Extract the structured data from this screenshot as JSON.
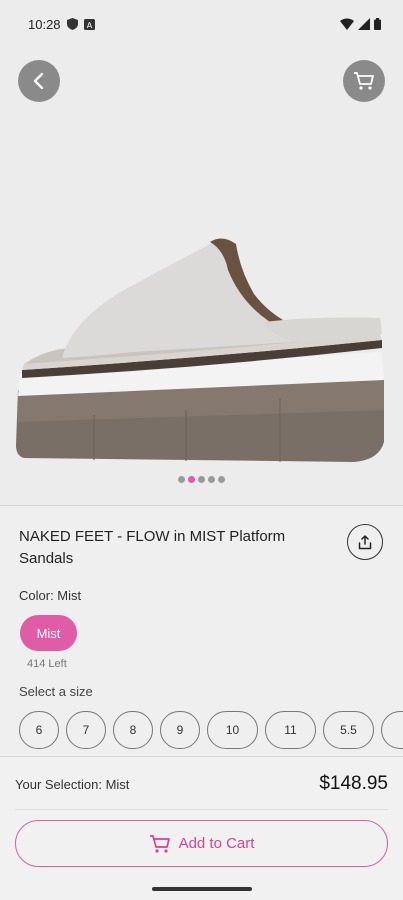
{
  "status_bar": {
    "time": "10:28"
  },
  "product": {
    "title": "NAKED FEET - FLOW in MIST Platform Sandals",
    "color_label": "Color: Mist",
    "selected_color": "Mist",
    "stock": "414 Left",
    "size_label": "Select a size",
    "sizes": [
      "6",
      "7",
      "8",
      "9",
      "10",
      "11",
      "5.5"
    ],
    "carousel": {
      "count": 5,
      "active_index": 1
    }
  },
  "footer": {
    "selection": "Your Selection: Mist",
    "price": "$148.95",
    "add_to_cart": "Add to Cart"
  },
  "colors": {
    "accent": "#e15ca6",
    "button_grey": "#8a8a8a"
  },
  "icons": [
    "back-arrow-icon",
    "cart-icon",
    "share-icon",
    "shield-icon",
    "a-icon",
    "wifi-icon",
    "signal-icon",
    "battery-icon"
  ]
}
